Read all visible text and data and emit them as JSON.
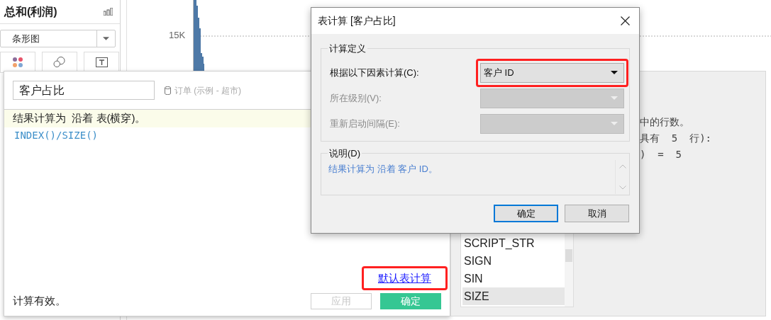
{
  "sidebar": {
    "title": "总和(利润)",
    "mark_type": "条形图",
    "mark_cards": [
      {
        "kind": "color"
      },
      {
        "kind": "size"
      },
      {
        "kind": "label"
      }
    ]
  },
  "chart": {
    "axis_label": "15K"
  },
  "calc_editor": {
    "name": "客户占比",
    "data_source": "订单 (示例 - 超市)",
    "hint": "结果计算为  沿着 表(横穿)。",
    "formula": "INDEX()/SIZE()",
    "default_link": {
      "label": "默认表计算",
      "highlighted": true
    },
    "status": "计算有效。",
    "buttons": [
      {
        "label": "应用",
        "disabled": true
      },
      {
        "label": "确定",
        "disabled": false
      }
    ]
  },
  "function_panel": {
    "functions": [
      {
        "name": "SCRIPT_STR",
        "selected": false
      },
      {
        "name": "SIGN",
        "selected": false
      },
      {
        "name": "SIN",
        "selected": false
      },
      {
        "name": "SIZE",
        "selected": true
      }
    ],
    "description_lines": [
      "中的行数。",
      "具有  5  行):",
      ")  =  5"
    ]
  },
  "dialog": {
    "title": "表计算 [客户占比]",
    "group_title": "计算定义",
    "fields": [
      {
        "label": "根据以下因素计算(C):",
        "value": "客户 ID",
        "disabled": false,
        "highlighted": true
      },
      {
        "label": "所在级别(V):",
        "disabled": true,
        "highlighted": false
      },
      {
        "label": "重新启动间隔(E):",
        "disabled": true,
        "highlighted": false
      }
    ],
    "description_title": "说明(D)",
    "description": "结果计算为 沿着 客户 ID。",
    "buttons": [
      {
        "label": "确定",
        "default": true
      },
      {
        "label": "取消",
        "default": false
      }
    ]
  }
}
